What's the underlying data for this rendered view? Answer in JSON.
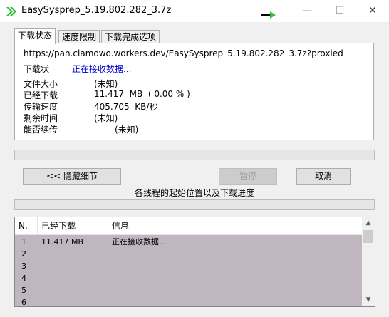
{
  "window": {
    "title": "EasySysprep_5.19.802.282_3.7z",
    "min_glyph": "—",
    "max_glyph": "☐",
    "close_glyph": "✕"
  },
  "tabs": [
    "下载状态",
    "速度限制",
    "下载完成选项"
  ],
  "status": {
    "url": "https://pan.clamowo.workers.dev/EasySysprep_5.19.802.282_3.7z?proxied",
    "state_label": "下载状",
    "state_value": "正在接收数据...",
    "rows": [
      {
        "label": "文件大小",
        "value": "(未知)"
      },
      {
        "label": "已经下载",
        "value": "11.417  MB  ( 0.00 % )"
      },
      {
        "label": "传输速度",
        "value": "405.705  KB/秒"
      },
      {
        "label": "剩余时间",
        "value": "(未知)"
      },
      {
        "label": "能否续传",
        "value": "(未知)"
      }
    ]
  },
  "overall_progress": 0.0,
  "buttons": {
    "hide_details": "<< 隐藏细节",
    "pause": "暂停",
    "cancel": "取消"
  },
  "segments_title": "各线程的起始位置以及下载进度",
  "segments_progress": 0.0,
  "table": {
    "columns": [
      "N.",
      "已经下载",
      "信息"
    ],
    "rows": [
      {
        "n": "1",
        "downloaded": "11.417 MB",
        "info": "正在接收数据..."
      },
      {
        "n": "2",
        "downloaded": "",
        "info": ""
      },
      {
        "n": "3",
        "downloaded": "",
        "info": ""
      },
      {
        "n": "4",
        "downloaded": "",
        "info": ""
      },
      {
        "n": "5",
        "downloaded": "",
        "info": ""
      },
      {
        "n": "6",
        "downloaded": "",
        "info": ""
      }
    ]
  },
  "colors": {
    "app_icon": "#2bbf3a",
    "status_text": "#0000cc",
    "table_body": "#c0b6c0"
  }
}
